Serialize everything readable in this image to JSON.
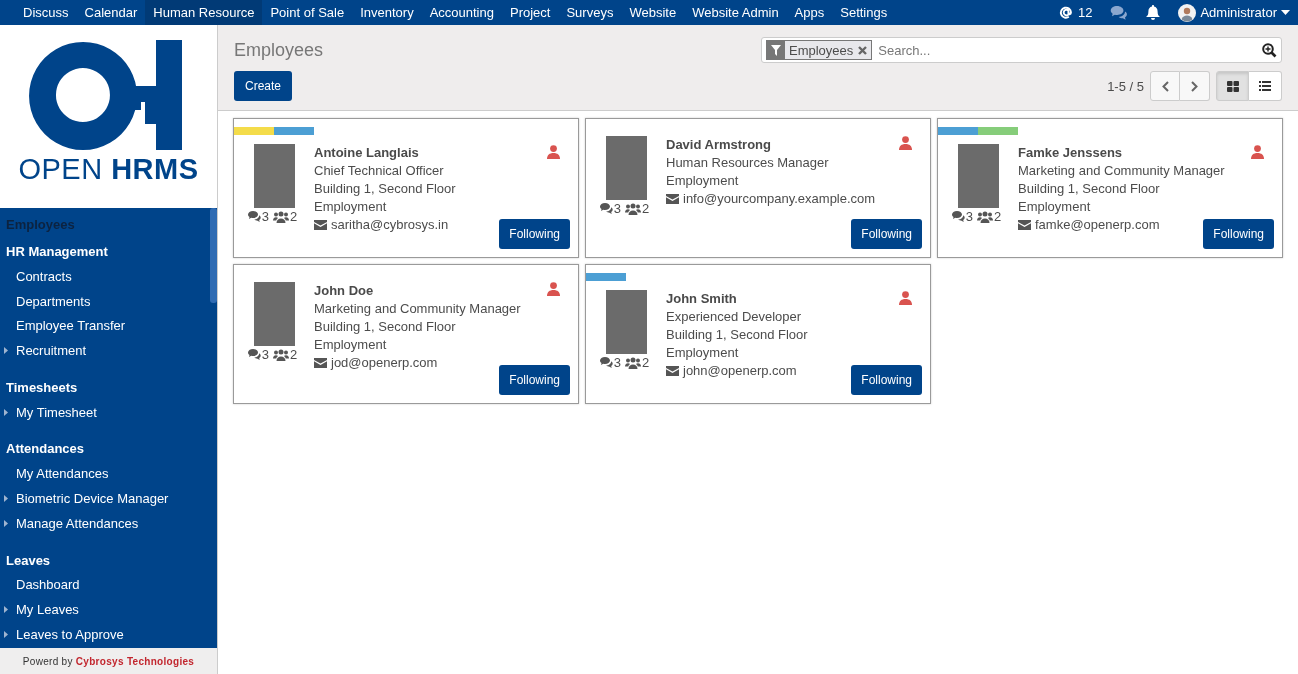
{
  "navbar": {
    "menus": [
      {
        "label": "Discuss",
        "selected": false
      },
      {
        "label": "Calendar",
        "selected": false
      },
      {
        "label": "Human Resource",
        "selected": true
      },
      {
        "label": "Point of Sale",
        "selected": false
      },
      {
        "label": "Inventory",
        "selected": false
      },
      {
        "label": "Accounting",
        "selected": false
      },
      {
        "label": "Project",
        "selected": false
      },
      {
        "label": "Surveys",
        "selected": false
      },
      {
        "label": "Website",
        "selected": false
      },
      {
        "label": "Website Admin",
        "selected": false
      },
      {
        "label": "Apps",
        "selected": false
      },
      {
        "label": "Settings",
        "selected": false
      }
    ],
    "mentions": "12",
    "user": "Administrator"
  },
  "sidebar": {
    "logo_text": "OPEN **HRMS**",
    "title": "Employees",
    "sections": [
      {
        "heading": "HR Management",
        "items": [
          {
            "label": "Contracts",
            "collapsed": false
          },
          {
            "label": "Departments",
            "collapsed": false
          },
          {
            "label": "Employee Transfer",
            "collapsed": false
          },
          {
            "label": "Recruitment",
            "collapsed": true
          }
        ]
      },
      {
        "heading": "Timesheets",
        "items": [
          {
            "label": "My Timesheet",
            "collapsed": true
          }
        ]
      },
      {
        "heading": "Attendances",
        "items": [
          {
            "label": "My Attendances",
            "collapsed": false
          },
          {
            "label": "Biometric Device Manager",
            "collapsed": true
          },
          {
            "label": "Manage Attendances",
            "collapsed": true
          }
        ]
      },
      {
        "heading": "Leaves",
        "items": [
          {
            "label": "Dashboard",
            "collapsed": false
          },
          {
            "label": "My Leaves",
            "collapsed": true
          },
          {
            "label": "Leaves to Approve",
            "collapsed": true
          }
        ]
      }
    ],
    "footer": "Powerd by **Cybrosys Technologies**"
  },
  "control_panel": {
    "breadcrumb": "Employees",
    "create_button": "Create",
    "search": {
      "facet": "Employees",
      "placeholder": "Search..."
    },
    "pager": "1-5 / 5",
    "views": [
      {
        "kind": "kanban",
        "selected": true
      },
      {
        "kind": "list",
        "selected": false
      }
    ]
  },
  "employees": [
    {
      "name": "Antoine Langlais",
      "job_title": "Chief Technical Officer",
      "location": "Building 1, Second Floor",
      "contract_type": "Employment",
      "email": "saritha@cybrosys.in",
      "messages": "3",
      "followers": "2",
      "button": "Following",
      "tags": [
        {
          "color": "#f4dc4a"
        },
        {
          "color": "#4c9fd4"
        }
      ]
    },
    {
      "name": "David Armstrong",
      "job_title": "Human Resources Manager",
      "contract_type": "Employment",
      "email": "info@yourcompany.example.com",
      "messages": "3",
      "followers": "2",
      "button": "Following"
    },
    {
      "name": "Famke Jenssens",
      "job_title": "Marketing and Community Manager",
      "location": "Building 1, Second Floor",
      "contract_type": "Employment",
      "email": "famke@openerp.com",
      "messages": "3",
      "followers": "2",
      "button": "Following",
      "tags": [
        {
          "color": "#4c9fd4"
        },
        {
          "color": "#86cd7a"
        }
      ]
    },
    {
      "name": "John Doe",
      "job_title": "Marketing and Community Manager",
      "location": "Building 1, Second Floor",
      "contract_type": "Employment",
      "email": "jod@openerp.com",
      "messages": "3",
      "followers": "2",
      "button": "Following"
    },
    {
      "name": "John Smith",
      "job_title": "Experienced Developer",
      "location": "Building 1, Second Floor",
      "contract_type": "Employment",
      "email": "john@openerp.com",
      "messages": "3",
      "followers": "2",
      "button": "Following",
      "tags": [
        {
          "color": "#4c9fd4"
        }
      ]
    }
  ]
}
